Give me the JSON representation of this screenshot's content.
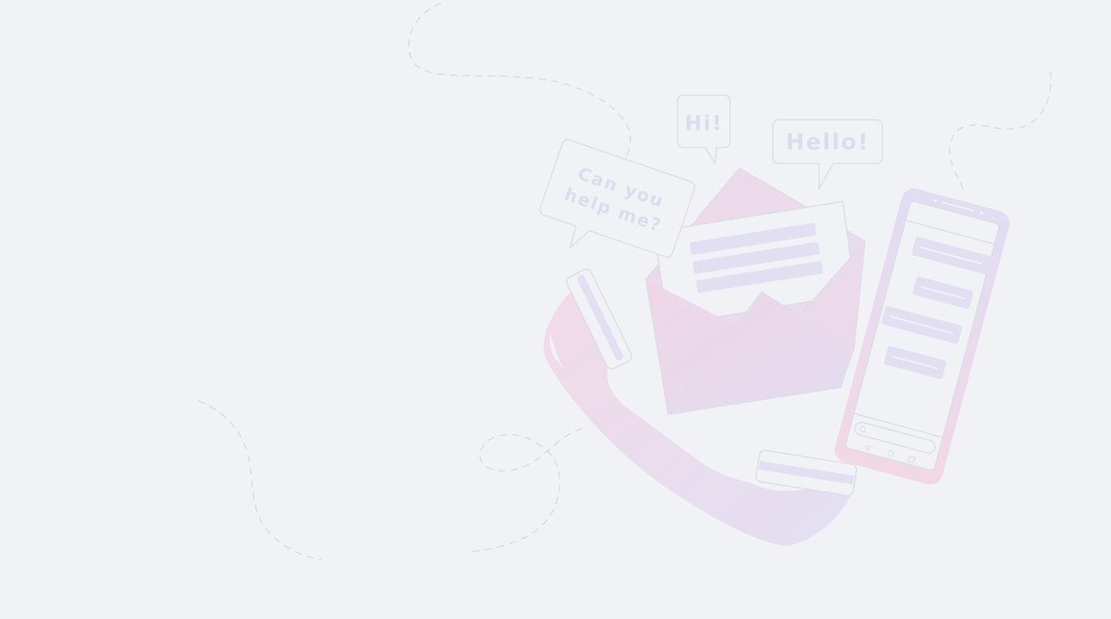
{
  "illustration": {
    "bubbles": {
      "hi": "Hi!",
      "hello": "Hello!",
      "help_line1": "Can you",
      "help_line2": "help me?"
    },
    "colors": {
      "background": "#f1f2f6",
      "outline": "#dcdce6",
      "lavender": "#e2dff3",
      "pink": "#f0d8e6",
      "dash": "#d8d9e0"
    }
  }
}
